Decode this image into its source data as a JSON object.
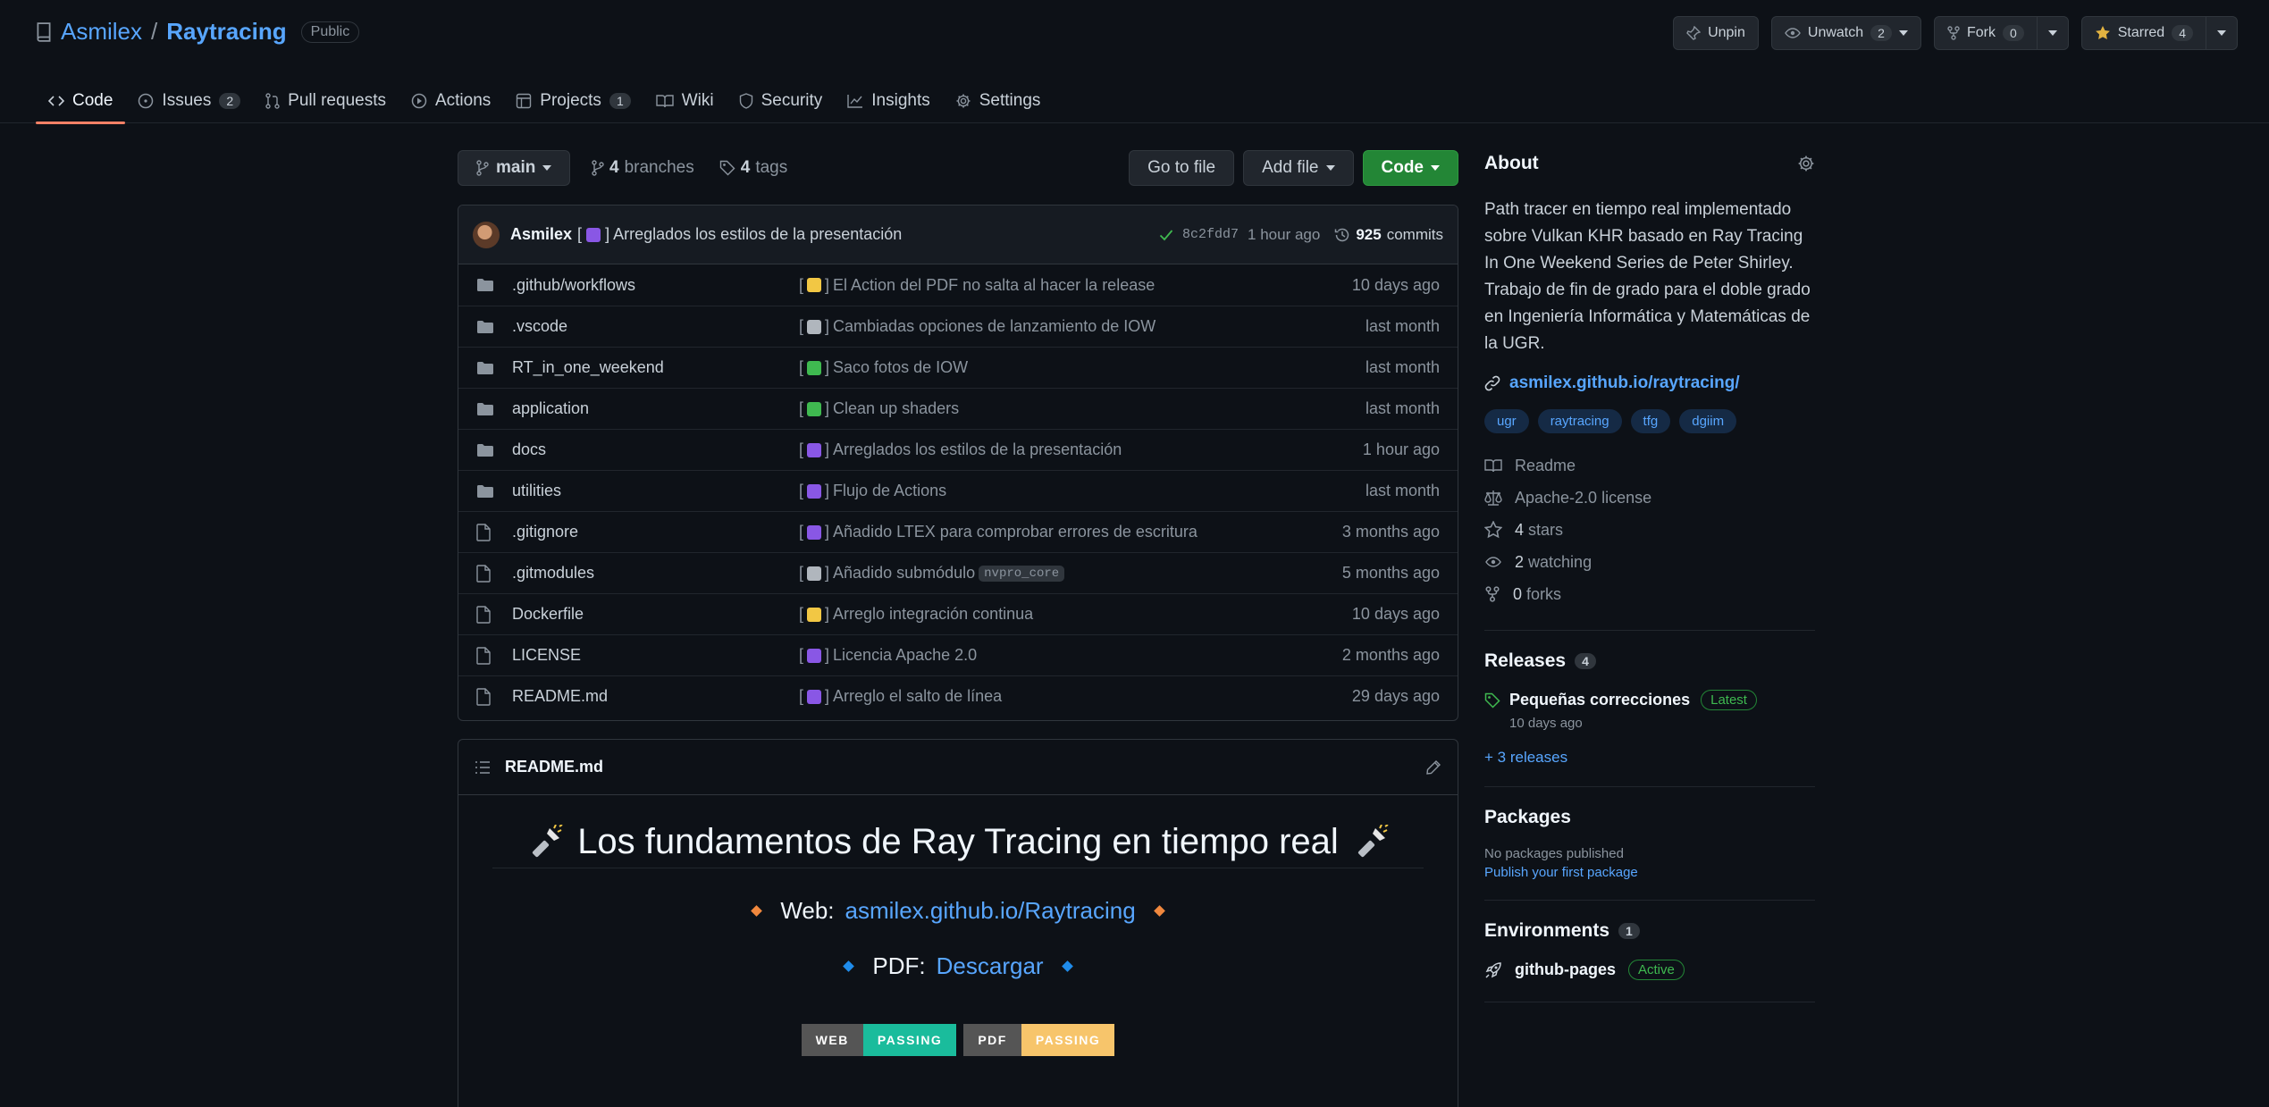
{
  "repo": {
    "owner": "Asmilex",
    "separator": "/",
    "name": "Raytracing",
    "visibility": "Public"
  },
  "header_buttons": {
    "unpin": "Unpin",
    "unwatch": "Unwatch",
    "watch_count": "2",
    "fork": "Fork",
    "fork_count": "0",
    "starred": "Starred",
    "star_count": "4"
  },
  "tabs": [
    {
      "label": "Code",
      "icon": "code-icon"
    },
    {
      "label": "Issues",
      "count": "2",
      "icon": "issue-icon"
    },
    {
      "label": "Pull requests",
      "icon": "pull-request-icon"
    },
    {
      "label": "Actions",
      "icon": "play-icon"
    },
    {
      "label": "Projects",
      "count": "1",
      "icon": "table-icon"
    },
    {
      "label": "Wiki",
      "icon": "book-icon"
    },
    {
      "label": "Security",
      "icon": "shield-icon"
    },
    {
      "label": "Insights",
      "icon": "graph-icon"
    },
    {
      "label": "Settings",
      "icon": "gear-icon"
    }
  ],
  "file_nav": {
    "branch": "main",
    "branches_count": "4",
    "branches_label": "branches",
    "tags_count": "4",
    "tags_label": "tags",
    "go_to_file": "Go to file",
    "add_file": "Add file",
    "code": "Code"
  },
  "latest_commit": {
    "author": "Asmilex",
    "message": "[ ] Arreglados los estilos de la presentación",
    "sha": "8c2fdd7",
    "age": "1 hour ago",
    "count": "925",
    "count_label": "commits"
  },
  "files": [
    {
      "type": "dir",
      "name": ".github/workflows",
      "message": "El Action del PDF no salta al hacer la release",
      "emoji_color": "#f2c744",
      "age": "10 days ago"
    },
    {
      "type": "dir",
      "name": ".vscode",
      "message": "Cambiadas opciones de lanzamiento de IOW",
      "emoji_color": "#b0b6bd",
      "age": "last month"
    },
    {
      "type": "dir",
      "name": "RT_in_one_weekend",
      "message": "Saco fotos de IOW",
      "emoji_color": "#3fb950",
      "age": "last month"
    },
    {
      "type": "dir",
      "name": "application",
      "message": "Clean up shaders",
      "emoji_color": "#3fb950",
      "age": "last month"
    },
    {
      "type": "dir",
      "name": "docs",
      "message": "Arreglados los estilos de la presentación",
      "emoji_color": "#8957e5",
      "age": "1 hour ago"
    },
    {
      "type": "dir",
      "name": "utilities",
      "message": "Flujo de Actions",
      "emoji_color": "#8957e5",
      "age": "last month"
    },
    {
      "type": "file",
      "name": ".gitignore",
      "message": "Añadido LTEX para comprobar errores de escritura",
      "emoji_color": "#8957e5",
      "age": "3 months ago"
    },
    {
      "type": "file",
      "name": ".gitmodules",
      "message": "Añadido submódulo",
      "code_chip": "nvpro_core",
      "emoji_color": "#b0b6bd",
      "age": "5 months ago"
    },
    {
      "type": "file",
      "name": "Dockerfile",
      "message": "Arreglo integración continua",
      "emoji_color": "#f2c744",
      "age": "10 days ago"
    },
    {
      "type": "file",
      "name": "LICENSE",
      "message": "Licencia Apache 2.0",
      "emoji_color": "#8957e5",
      "age": "2 months ago"
    },
    {
      "type": "file",
      "name": "README.md",
      "message": "Arreglo el salto de línea",
      "emoji_color": "#8957e5",
      "age": "29 days ago"
    }
  ],
  "readme": {
    "filename": "README.md",
    "title": "Los fundamentos de Ray Tracing en tiempo real",
    "web_label": "Web:",
    "web_link": "asmilex.github.io/Raytracing",
    "pdf_label": "PDF:",
    "pdf_link": "Descargar",
    "badges": [
      {
        "key": "WEB",
        "value": "PASSING",
        "color": "#1abc9c"
      },
      {
        "key": "PDF",
        "value": "PASSING",
        "color": "#f7c56b"
      }
    ]
  },
  "about": {
    "heading": "About",
    "description": "Path tracer en tiempo real implementado sobre Vulkan KHR basado en Ray Tracing In One Weekend Series de Peter Shirley. Trabajo de fin de grado para el doble grado en Ingeniería Informática y Matemáticas de la UGR.",
    "link": "asmilex.github.io/raytracing/",
    "topics": [
      "ugr",
      "raytracing",
      "tfg",
      "dgiim"
    ],
    "readme": "Readme",
    "license": "Apache-2.0 license",
    "stars_count": "4",
    "stars_label": "stars",
    "watching_count": "2",
    "watching_label": "watching",
    "forks_count": "0",
    "forks_label": "forks"
  },
  "releases": {
    "heading": "Releases",
    "count": "4",
    "latest_name": "Pequeñas correcciones",
    "latest_badge": "Latest",
    "latest_date": "10 days ago",
    "more": "+ 3 releases"
  },
  "packages": {
    "heading": "Packages",
    "none": "No packages published",
    "publish": "Publish your first package"
  },
  "environments": {
    "heading": "Environments",
    "count": "1",
    "name": "github-pages",
    "status": "Active"
  },
  "colors": {
    "accent": "#58a6ff",
    "tab_underline": "#f78166",
    "primary_button": "#238636",
    "diamond_orange": "#f0883e",
    "diamond_blue": "#1f8ceb"
  }
}
